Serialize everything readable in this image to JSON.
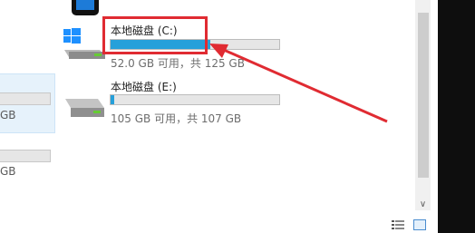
{
  "drives": [
    {
      "name": "本地磁盘 (C:)",
      "space": "52.0 GB 可用，共 125 GB",
      "fill": 0.59,
      "icon": "windows-drive-icon"
    },
    {
      "name": "本地磁盘 (E:)",
      "space": "105 GB 可用，共 107 GB",
      "fill": 0.02,
      "icon": "hard-drive-icon"
    }
  ],
  "left_partial": {
    "text1": "GB",
    "text2": "GB"
  },
  "scrollbar": {
    "down_arrow": "∨"
  },
  "colors": {
    "bar_fill": "#26a0da",
    "highlight": "#e02b32",
    "selection": "#e6f2fb"
  }
}
